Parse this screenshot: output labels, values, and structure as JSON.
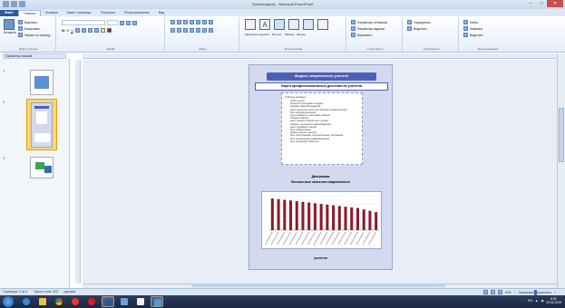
{
  "window": {
    "title": "Презентация1 - Microsoft PowerPoint",
    "controls": [
      "–",
      "□",
      "✕"
    ]
  },
  "ribbon_tabs": [
    "Файл",
    "Главная",
    "Вставка",
    "Макет страницы",
    "Рассылки",
    "Рецензирование",
    "Вид"
  ],
  "ribbon": {
    "clipboard": {
      "label": "Буфер обмена",
      "paste": "Вставить",
      "cut": "Вырезать",
      "copy": "Копировать",
      "format_painter": "Формат по образцу"
    },
    "font": {
      "label": "Шрифт",
      "name": "",
      "size": ""
    },
    "paragraph": {
      "label": "Абзац"
    },
    "illustrations": {
      "label": "Иллюстрации",
      "items": [
        "Нарисовать надпись",
        "Рисунок",
        "Таблица",
        "Фигуры",
        "Упорядочить"
      ]
    },
    "arrange": {
      "label": "Упорядочить",
      "items": [
        "Упорядочить",
        "Выделить"
      ]
    },
    "styles": {
      "label": "Стили фигур",
      "items": [
        "Параметры обтекания",
        "Параметры надписи",
        "Выровнять"
      ]
    },
    "editing": {
      "label": "Редактирование",
      "items": [
        "Найти",
        "Заменить",
        "Выделить"
      ]
    }
  },
  "pane": {
    "header": "Параметры эскизов",
    "slides": [
      {
        "number": "1"
      },
      {
        "number": "2"
      },
      {
        "number": "3"
      }
    ]
  },
  "slide": {
    "title": "Модель современного учителя",
    "subtitle": "Карта профессиональных достоинств учителя",
    "list_title": "Учитель должен:",
    "list_items": [
      "любить детей;",
      "интересно преподавать предмет;",
      "обладать широкой эрудицией;",
      "уметь интересно и доступно объяснять новый материал;",
      "быть доброжелательным;",
      "уметь понимать и чувствовать ребёнка;",
      "обладать юмором;",
      "уметь находить общий язык с детьми;",
      "обладать терпением и самообладанием;",
      "уметь сдерживать эмоции;",
      "быть справедливым;",
      "уважать мнение учеников;",
      "быть ответственным, исполнительным, увлечённым;",
      "быть эмоционально уравновешенным;",
      "быть интересной личностью."
    ],
    "section_title": "Диаграмма",
    "section_subtitle": "Личностные качества современного",
    "caption": "учителя"
  },
  "chart_data": {
    "type": "bar",
    "categories": [
      "1",
      "2",
      "3",
      "4",
      "5",
      "6",
      "7",
      "8",
      "9",
      "10",
      "11",
      "12",
      "13",
      "14",
      "15",
      "16",
      "17",
      "18"
    ],
    "values": [
      92,
      90,
      88,
      86,
      84,
      82,
      80,
      78,
      76,
      74,
      72,
      70,
      68,
      66,
      64,
      60,
      56,
      52
    ],
    "ylim": [
      0,
      100
    ],
    "grid": true,
    "color": "#8b1a2b"
  },
  "status": {
    "slide_info": "Страница: 2 из 4",
    "words": "Число слов: 203",
    "language": "русский",
    "zoom": "60%"
  },
  "taskbar": {
    "time": "8:51",
    "date": "15.04.2016",
    "lang": "RU"
  },
  "colors": {
    "accent": "#2a5a9e",
    "slide_bg": "#d3daf0",
    "title_fill": "#4e5fb8",
    "bar": "#8b1a2b"
  }
}
